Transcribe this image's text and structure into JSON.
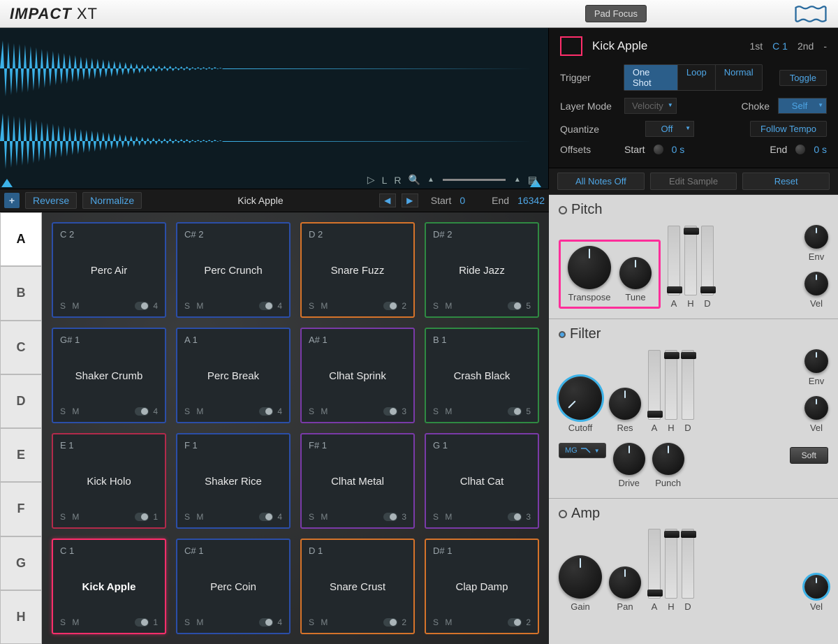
{
  "title": {
    "brand1": "IMPACT",
    "brand2": "XT",
    "padFocus": "Pad Focus"
  },
  "sample": {
    "name": "Kick Apple",
    "reverse": "Reverse",
    "normalize": "Normalize",
    "startLabel": "Start",
    "startVal": "0",
    "endLabel": "End",
    "endVal": "16342",
    "wave_toolbar": {
      "L": "L",
      "R": "R"
    }
  },
  "banks": [
    "A",
    "B",
    "C",
    "D",
    "E",
    "F",
    "G",
    "H"
  ],
  "activeBank": "A",
  "pads": [
    {
      "note": "C 2",
      "name": "Perc Air",
      "out": "4",
      "border": "#2b4ea8"
    },
    {
      "note": "C# 2",
      "name": "Perc Crunch",
      "out": "4",
      "border": "#2b4ea8"
    },
    {
      "note": "D 2",
      "name": "Snare Fuzz",
      "out": "2",
      "border": "#d6732a"
    },
    {
      "note": "D# 2",
      "name": "Ride Jazz",
      "out": "5",
      "border": "#2f8a42"
    },
    {
      "note": "G# 1",
      "name": "Shaker Crumb",
      "out": "4",
      "border": "#2b4ea8"
    },
    {
      "note": "A 1",
      "name": "Perc Break",
      "out": "4",
      "border": "#2b4ea8"
    },
    {
      "note": "A# 1",
      "name": "Clhat Sprink",
      "out": "3",
      "border": "#7a3aa8"
    },
    {
      "note": "B 1",
      "name": "Crash Black",
      "out": "5",
      "border": "#2f8a42"
    },
    {
      "note": "E 1",
      "name": "Kick Holo",
      "out": "1",
      "border": "#b32a4b"
    },
    {
      "note": "F 1",
      "name": "Shaker Rice",
      "out": "4",
      "border": "#2b4ea8"
    },
    {
      "note": "F# 1",
      "name": "Clhat Metal",
      "out": "3",
      "border": "#7a3aa8"
    },
    {
      "note": "G 1",
      "name": "Clhat Cat",
      "out": "3",
      "border": "#7a3aa8"
    },
    {
      "note": "C 1",
      "name": "Kick Apple",
      "out": "1",
      "border": "#ff2e6b",
      "selected": true
    },
    {
      "note": "C# 1",
      "name": "Perc Coin",
      "out": "4",
      "border": "#2b4ea8"
    },
    {
      "note": "D 1",
      "name": "Snare Crust",
      "out": "2",
      "border": "#d6732a"
    },
    {
      "note": "D# 1",
      "name": "Clap Damp",
      "out": "2",
      "border": "#d6732a"
    }
  ],
  "padLabels": {
    "s": "S",
    "m": "M"
  },
  "info": {
    "name": "Kick Apple",
    "slots": {
      "s1": "1st",
      "s1v": "C 1",
      "s2": "2nd",
      "s2v": "-"
    },
    "trigger": {
      "label": "Trigger",
      "oneShot": "One Shot",
      "loop": "Loop",
      "normal": "Normal",
      "toggle": "Toggle"
    },
    "layer": {
      "label": "Layer Mode",
      "value": "Velocity"
    },
    "choke": {
      "label": "Choke",
      "value": "Self"
    },
    "quantize": {
      "label": "Quantize",
      "value": "Off",
      "follow": "Follow Tempo"
    },
    "offsets": {
      "label": "Offsets",
      "start": "Start",
      "startVal": "0 s",
      "end": "End",
      "endVal": "0 s"
    }
  },
  "actions": {
    "allNotes": "All Notes Off",
    "edit": "Edit Sample",
    "reset": "Reset"
  },
  "pitch": {
    "title": "Pitch",
    "transpose": "Transpose",
    "tune": "Tune",
    "env": "Env",
    "vel": "Vel",
    "a": "A",
    "h": "H",
    "d": "D"
  },
  "filter": {
    "title": "Filter",
    "cutoff": "Cutoff",
    "res": "Res",
    "drive": "Drive",
    "punch": "Punch",
    "env": "Env",
    "vel": "Vel",
    "a": "A",
    "h": "H",
    "d": "D",
    "soft": "Soft",
    "type": "MG"
  },
  "amp": {
    "title": "Amp",
    "gain": "Gain",
    "pan": "Pan",
    "vel": "Vel",
    "a": "A",
    "h": "H",
    "d": "D"
  }
}
